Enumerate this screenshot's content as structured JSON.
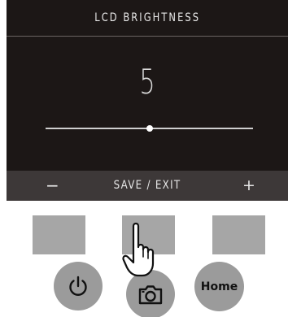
{
  "lcd": {
    "title": "LCD BRIGHTNESS",
    "value": "5",
    "slider": {
      "level": 0.5
    },
    "footer": {
      "minus": "−",
      "save_exit": "SAVE / EXIT",
      "plus": "+"
    }
  },
  "buttons": {
    "home_label": "Home"
  },
  "icons": {
    "power": "power-icon",
    "camera": "camera-icon",
    "pointer": "hand-pointer-icon"
  },
  "colors": {
    "lcd_background": "#1c1716",
    "lcd_footer": "#3d3838",
    "key_gray": "#a6a6a6",
    "button_gray": "#9b9b9b"
  }
}
